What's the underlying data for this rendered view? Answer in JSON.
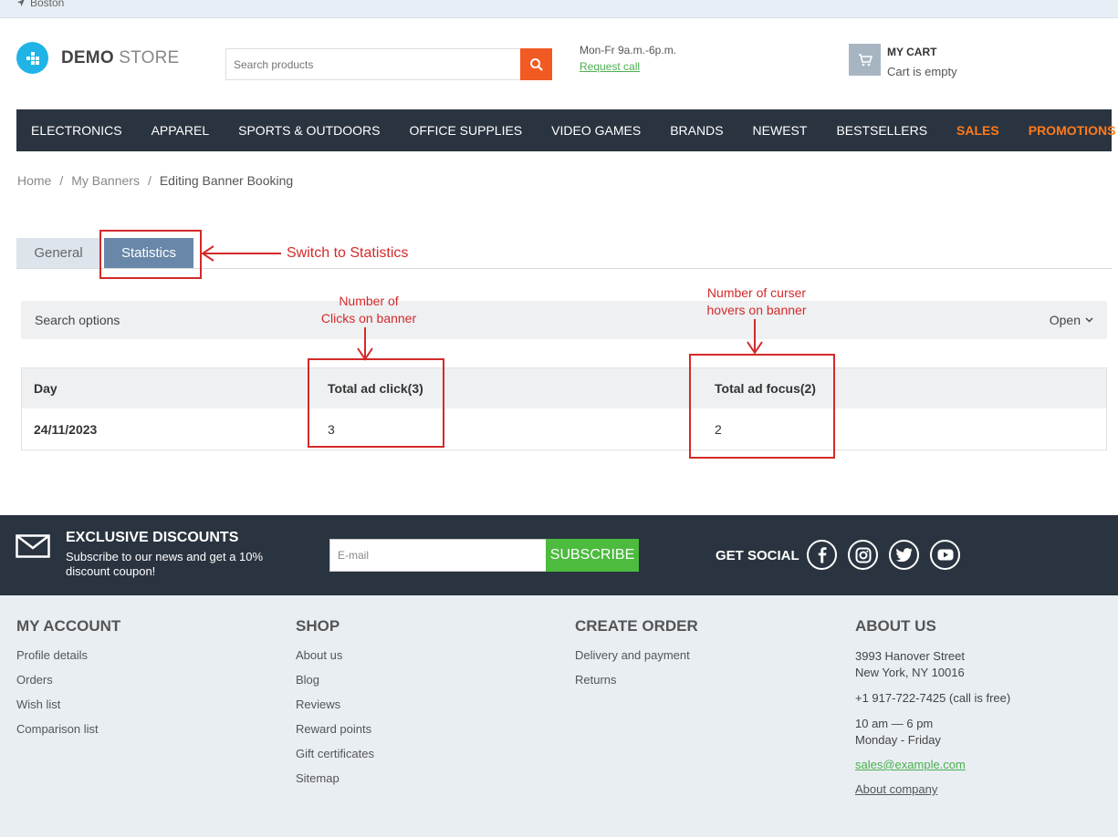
{
  "topbar": {
    "location": "Boston"
  },
  "logo": {
    "bold": "DEMO",
    "light": "STORE"
  },
  "search": {
    "placeholder": "Search products"
  },
  "contact": {
    "hours": "Mon-Fr 9a.m.-6p.m.",
    "request_call": "Request call"
  },
  "cart": {
    "title": "MY CART",
    "status": "Cart is empty"
  },
  "nav": {
    "items": [
      "ELECTRONICS",
      "APPAREL",
      "SPORTS & OUTDOORS",
      "OFFICE SUPPLIES",
      "VIDEO GAMES",
      "BRANDS",
      "NEWEST",
      "BESTSELLERS"
    ],
    "highlight": [
      "SALES",
      "PROMOTIONS"
    ],
    "highlight_color": "#ff7a1a"
  },
  "breadcrumb": {
    "home": "Home",
    "sep": "/",
    "banners": "My Banners",
    "current": "Editing Banner Booking"
  },
  "tabs": {
    "general": "General",
    "statistics": "Statistics"
  },
  "annotations": {
    "switch": "Switch to Statistics",
    "clicks_line1": "Number of",
    "clicks_line2": "Clicks on banner",
    "hovers_line1": "Number of curser",
    "hovers_line2": "hovers on banner",
    "color": "#d42a2a"
  },
  "search_options": {
    "label": "Search options",
    "toggle": "Open"
  },
  "stats_table": {
    "headers": [
      "Day",
      "Total ad click(3)",
      "Total ad focus(2)"
    ],
    "rows": [
      [
        "24/11/2023",
        "3",
        "2"
      ]
    ]
  },
  "subscribe": {
    "title": "EXCLUSIVE DISCOUNTS",
    "desc": "Subscribe to our news and get a 10% discount coupon!",
    "email_placeholder": "E-mail",
    "button": "Subscribe",
    "social_label": "GET SOCIAL",
    "button_color": "#4cbb3e"
  },
  "footer": {
    "my_account": {
      "title": "MY ACCOUNT",
      "links": [
        "Profile details",
        "Orders",
        "Wish list",
        "Comparison list"
      ]
    },
    "shop": {
      "title": "SHOP",
      "links": [
        "About us",
        "Blog",
        "Reviews",
        "Reward points",
        "Gift certificates",
        "Sitemap"
      ]
    },
    "create_order": {
      "title": "CREATE ORDER",
      "links": [
        "Delivery and payment",
        "Returns"
      ]
    },
    "about": {
      "title": "ABOUT US",
      "address1": "3993 Hanover Street",
      "address2": "New York, NY 10016",
      "phone": "+1 917-722-7425 (call is free)",
      "hours1": "10 am — 6 pm",
      "hours2": "Monday - Friday",
      "email": "sales@example.com",
      "company": "About company"
    }
  }
}
